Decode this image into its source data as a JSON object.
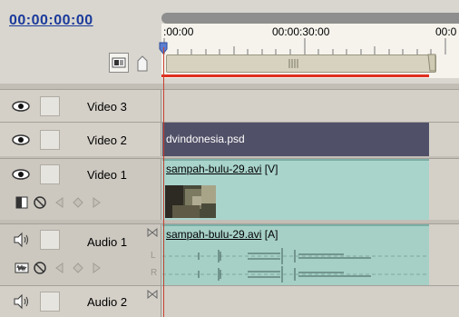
{
  "header": {
    "timecode": "00:00:00:00",
    "ruler_labels": [
      ":00:00",
      "00:00:30:00",
      "00:0"
    ]
  },
  "tracks": {
    "video3": {
      "name": "Video 3"
    },
    "video2": {
      "name": "Video 2",
      "clip": "dvindonesia.psd"
    },
    "video1": {
      "name": "Video 1",
      "clip_name": "sampah-bulu-29.avi",
      "clip_suffix": " [V]"
    },
    "audio1": {
      "name": "Audio 1",
      "clip_name": "sampah-bulu-29.avi",
      "clip_suffix": " [A]",
      "channel_l": "L",
      "channel_r": "R"
    },
    "audio2": {
      "name": "Audio 2"
    }
  },
  "colors": {
    "timecode": "#1b3a9c",
    "video_clip": "#505068",
    "video1_clip": "#a9d4cc",
    "audio_clip": "#a6d0c6",
    "playhead": "#e03020"
  },
  "icons": [
    "snap-icon",
    "marker-icon",
    "eye-icon",
    "speaker-icon",
    "expand-triangle-icon",
    "collapse-triangle-icon",
    "display-style-icon",
    "hide-keyframes-icon",
    "prev-keyframe-icon",
    "add-keyframe-icon",
    "next-keyframe-icon",
    "waveform-icon",
    "sync-lock-icon"
  ]
}
